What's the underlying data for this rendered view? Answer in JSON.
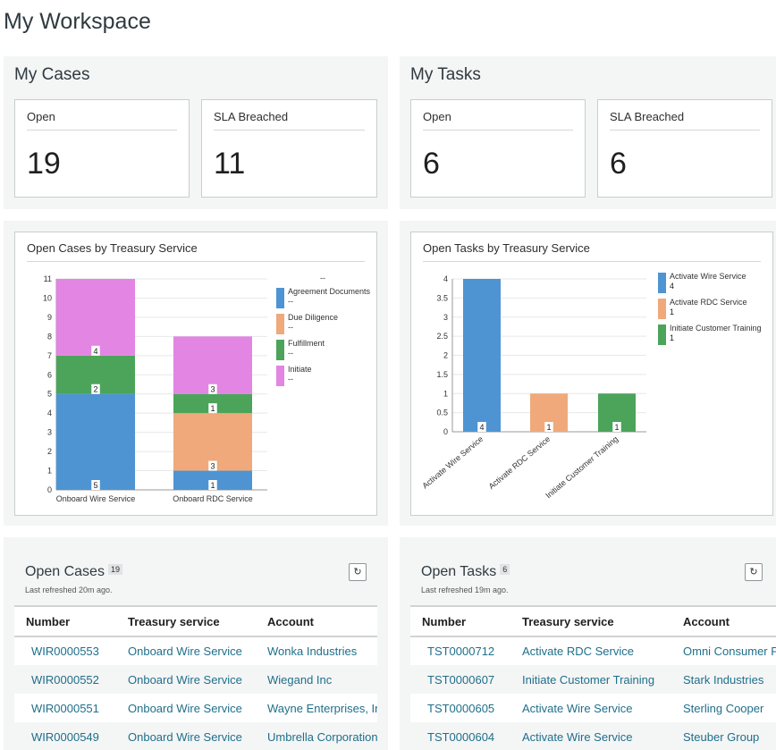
{
  "page": {
    "title": "My Workspace"
  },
  "cases_panel": {
    "title": "My Cases",
    "cards": [
      {
        "label": "Open",
        "value": "19"
      },
      {
        "label": "SLA Breached",
        "value": "11"
      }
    ]
  },
  "tasks_panel": {
    "title": "My Tasks",
    "cards": [
      {
        "label": "Open",
        "value": "6"
      },
      {
        "label": "SLA Breached",
        "value": "6"
      }
    ]
  },
  "chart_data": [
    {
      "type": "bar",
      "stacked": true,
      "title": "Open Cases by Treasury Service",
      "categories": [
        "Onboard Wire Service",
        "Onboard RDC Service"
      ],
      "series": [
        {
          "name": "Agreement Documents",
          "legend_value": "--",
          "color": "#4e94d3",
          "values": [
            5,
            1
          ]
        },
        {
          "name": "Due Diligence",
          "legend_value": "--",
          "color": "#f0a97a",
          "values": [
            0,
            3
          ]
        },
        {
          "name": "Fulfillment",
          "legend_value": "--",
          "color": "#4ba45a",
          "values": [
            2,
            1
          ]
        },
        {
          "name": "Initiate",
          "legend_value": "--",
          "color": "#e385e3",
          "values": [
            4,
            3
          ]
        }
      ],
      "legend_header": "--",
      "ylim": [
        0,
        11
      ],
      "yticks": [
        "0",
        "1",
        "2",
        "3",
        "4",
        "5",
        "6",
        "7",
        "8",
        "9",
        "10",
        "11"
      ],
      "grid": true,
      "legend_position": "right"
    },
    {
      "type": "bar",
      "title": "Open Tasks by Treasury Service",
      "categories": [
        "Activate Wire Service",
        "Activate RDC Service",
        "Initiate Customer Training"
      ],
      "values": [
        4,
        1,
        1
      ],
      "value_labels": [
        "4",
        "1",
        "1"
      ],
      "colors": [
        "#4e94d3",
        "#f0a97a",
        "#4ba45a"
      ],
      "legend": [
        {
          "name": "Activate Wire Service",
          "value": "4",
          "color": "#4e94d3"
        },
        {
          "name": "Activate RDC Service",
          "value": "1",
          "color": "#f0a97a"
        },
        {
          "name": "Initiate Customer Training",
          "value": "1",
          "color": "#4ba45a"
        }
      ],
      "ylim": [
        0,
        4
      ],
      "yticks": [
        "0",
        "0.5",
        "1",
        "1.5",
        "2",
        "2.5",
        "3",
        "3.5",
        "4"
      ],
      "grid": true,
      "legend_position": "right"
    }
  ],
  "open_cases": {
    "title": "Open Cases",
    "count": "19",
    "refreshed": "Last refreshed 20m ago.",
    "columns": [
      "Number",
      "Treasury service",
      "Account"
    ],
    "rows": [
      [
        "WIR0000553",
        "Onboard Wire Service",
        "Wonka Industries"
      ],
      [
        "WIR0000552",
        "Onboard Wire Service",
        "Wiegand Inc"
      ],
      [
        "WIR0000551",
        "Onboard Wire Service",
        "Wayne Enterprises, Inc."
      ],
      [
        "WIR0000549",
        "Onboard Wire Service",
        "Umbrella Corporation"
      ]
    ]
  },
  "open_tasks": {
    "title": "Open Tasks",
    "count": "6",
    "refreshed": "Last refreshed 19m ago.",
    "columns": [
      "Number",
      "Treasury service",
      "Account"
    ],
    "rows": [
      [
        "TST0000712",
        "Activate RDC Service",
        "Omni Consumer Products"
      ],
      [
        "TST0000607",
        "Initiate Customer Training",
        "Stark Industries"
      ],
      [
        "TST0000605",
        "Activate Wire Service",
        "Sterling Cooper"
      ],
      [
        "TST0000604",
        "Activate Wire Service",
        "Steuber Group"
      ]
    ]
  },
  "icons": {
    "refresh": "refresh-icon"
  }
}
